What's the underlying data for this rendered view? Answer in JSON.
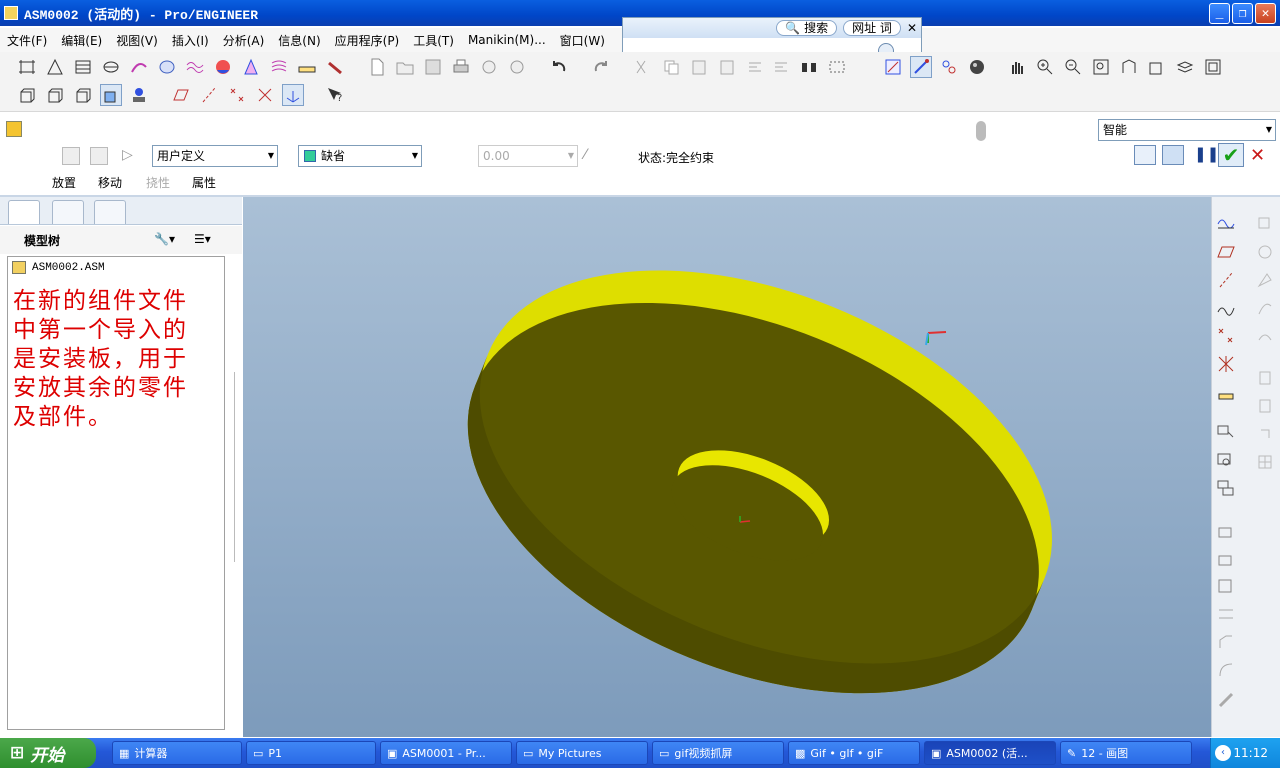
{
  "window": {
    "title": "ASM0002 (活动的) - Pro/ENGINEER"
  },
  "menu": [
    "文件(F)",
    "编辑(E)",
    "视图(V)",
    "插入(I)",
    "分析(A)",
    "信息(N)",
    "应用程序(P)",
    "工具(T)",
    "Manikin(M)...",
    "窗口(W)"
  ],
  "popup": {
    "search_label": "搜索",
    "url_label": "网址",
    "extra_label": "词"
  },
  "dashboard": {
    "constraint_select": "用户定义",
    "default_select": "缺省",
    "offset_value": "0.00",
    "status": "状态:完全约束",
    "smart_select": "智能",
    "tabs": [
      "放置",
      "移动",
      "挠性",
      "属性"
    ]
  },
  "model_tree": {
    "header": "模型树",
    "root_item": "ASM0002.ASM",
    "annotation": "在新的组件文件中第一个导入的是安装板，用于安放其余的零件及部件。",
    "annotation_color": "#dd0000"
  },
  "model": {
    "color": "#e6e200"
  },
  "taskbar": {
    "start_label": "开始",
    "tasks": [
      "计算器",
      "P1",
      "ASM0001 - Pr...",
      "My Pictures",
      "gif视频抓屏",
      "Gif • gIf • giF",
      "ASM0002 (活...",
      "12 - 画图"
    ],
    "clock": "11:12"
  }
}
